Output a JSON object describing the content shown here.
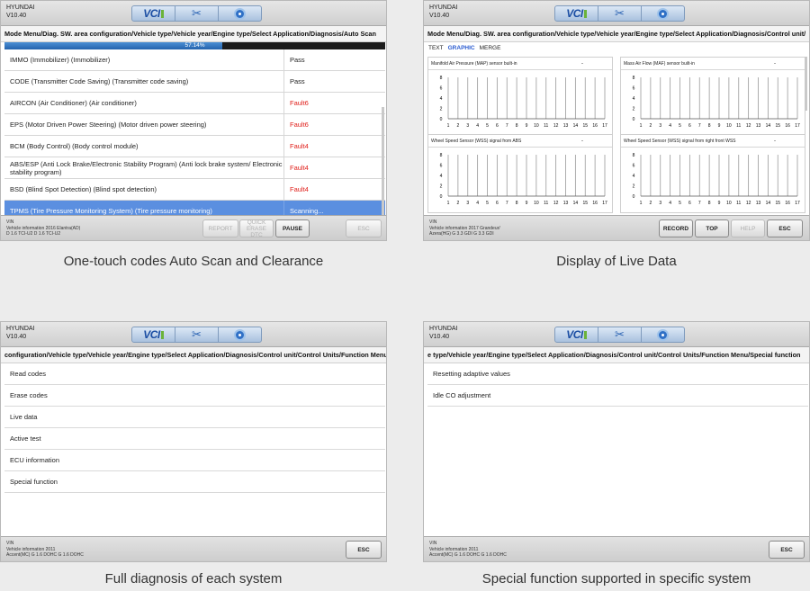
{
  "panels": [
    {
      "brand": "HYUNDAI",
      "version": "V10.40",
      "breadcrumb": "Mode Menu/Diag. SW. area configuration/Vehicle type/Vehicle year/Engine type/Select Application/Diagnosis/Auto Scan",
      "progress_label": "57.14%",
      "progress_value": 57.14,
      "rows": [
        {
          "name": "IMMO (Immobilizer) (Immobilizer)",
          "status": "Pass",
          "state": "pass"
        },
        {
          "name": "CODE (Transmitter Code Saving) (Transmitter code saving)",
          "status": "Pass",
          "state": "pass"
        },
        {
          "name": "AIRCON (Air Conditioner) (Air conditioner)",
          "status": "Fault6",
          "state": "fault"
        },
        {
          "name": "EPS (Motor Driven Power Steering) (Motor driven power steering)",
          "status": "Fault6",
          "state": "fault"
        },
        {
          "name": "BCM (Body Control) (Body control module)",
          "status": "Fault4",
          "state": "fault"
        },
        {
          "name": "ABS/ESP (Anti Lock Brake/Electronic Stability Program) (Anti lock brake system/ Electronic stability program)",
          "status": "Fault4",
          "state": "fault"
        },
        {
          "name": "BSD (Blind Spot Detection) (Blind spot detection)",
          "status": "Fault4",
          "state": "fault"
        },
        {
          "name": "TPMS (Tire Pressure Monitoring System) (Tire pressure monitoring)",
          "status": "Scanning...",
          "state": "active"
        }
      ],
      "vin_label": "VIN",
      "vehicle_info": "Vehicle information 2016 Elantra(AD)",
      "engine_info": "D 1.6 TCI-U2 D 1.6 TCI-U2",
      "buttons": [
        "REPORT",
        "QUICK ERASE DTC",
        "PAUSE",
        "ESC"
      ],
      "caption": "One-touch codes Auto Scan and Clearance"
    },
    {
      "brand": "HYUNDAI",
      "version": "V10.40",
      "breadcrumb": "Mode Menu/Diag. SW. area configuration/Vehicle type/Vehicle year/Engine type/Select Application/Diagnosis/Control unit/",
      "tabs": [
        "TEXT",
        "GRAPHIC",
        "MERGE"
      ],
      "graphs": [
        {
          "title": "Manifold Air Pressure (MAP) sensor built-in",
          "value": "-"
        },
        {
          "title": "Mass Air Flow (MAF) sensor built-in",
          "value": "-"
        },
        {
          "title": "Wheel Speed Sensor (WSS) signal from ABS",
          "value": "-"
        },
        {
          "title": "Wheel Speed Sensor (WSS) signal from right front WSS",
          "value": "-"
        }
      ],
      "x_ticks": [
        "1",
        "2",
        "3",
        "4",
        "5",
        "6",
        "7",
        "8",
        "9",
        "10",
        "11",
        "12",
        "13",
        "14",
        "15",
        "16",
        "17"
      ],
      "y_ticks": [
        "8",
        "6",
        "4",
        "2",
        "0"
      ],
      "vin_label": "VIN",
      "vehicle_info": "Vehicle information 2017 Grandeur/",
      "engine_info": "Azera(HG) G 3.3 GDI G 3.3 GDI",
      "buttons": [
        "RECORD",
        "TOP",
        "HELP",
        "ESC"
      ],
      "caption": "Display of Live Data"
    },
    {
      "brand": "HYUNDAI",
      "version": "V10.40",
      "breadcrumb": "configuration/Vehicle type/Vehicle year/Engine type/Select Application/Diagnosis/Control unit/Control Units/Function Menu",
      "items": [
        "Read codes",
        "Erase codes",
        "Live data",
        "Active test",
        "ECU information",
        "Special function"
      ],
      "vin_label": "VIN",
      "vehicle_info": "Vehicle information 2011",
      "engine_info": "Accent(MC) G 1.6 DOHC G 1.6 DOHC",
      "buttons": [
        "ESC"
      ],
      "caption": "Full diagnosis of each system"
    },
    {
      "brand": "HYUNDAI",
      "version": "V10.40",
      "breadcrumb": "e type/Vehicle year/Engine type/Select Application/Diagnosis/Control unit/Control Units/Function Menu/Special function",
      "items": [
        "Resetting adaptive values",
        "Idle CO adjustment"
      ],
      "vin_label": "VIN",
      "vehicle_info": "Vehicle information 2011",
      "engine_info": "Accent(MC) G 1.6 DOHC G 1.6 DOHC",
      "buttons": [
        "ESC"
      ],
      "caption": "Special function supported in specific system"
    }
  ],
  "toolbar_icons": [
    "vci-icon",
    "tools-icon",
    "disc-icon"
  ],
  "colors": {
    "fault": "#e0201b",
    "highlight": "#5b8fe0",
    "graphic_tab": "#2a5bd0"
  }
}
